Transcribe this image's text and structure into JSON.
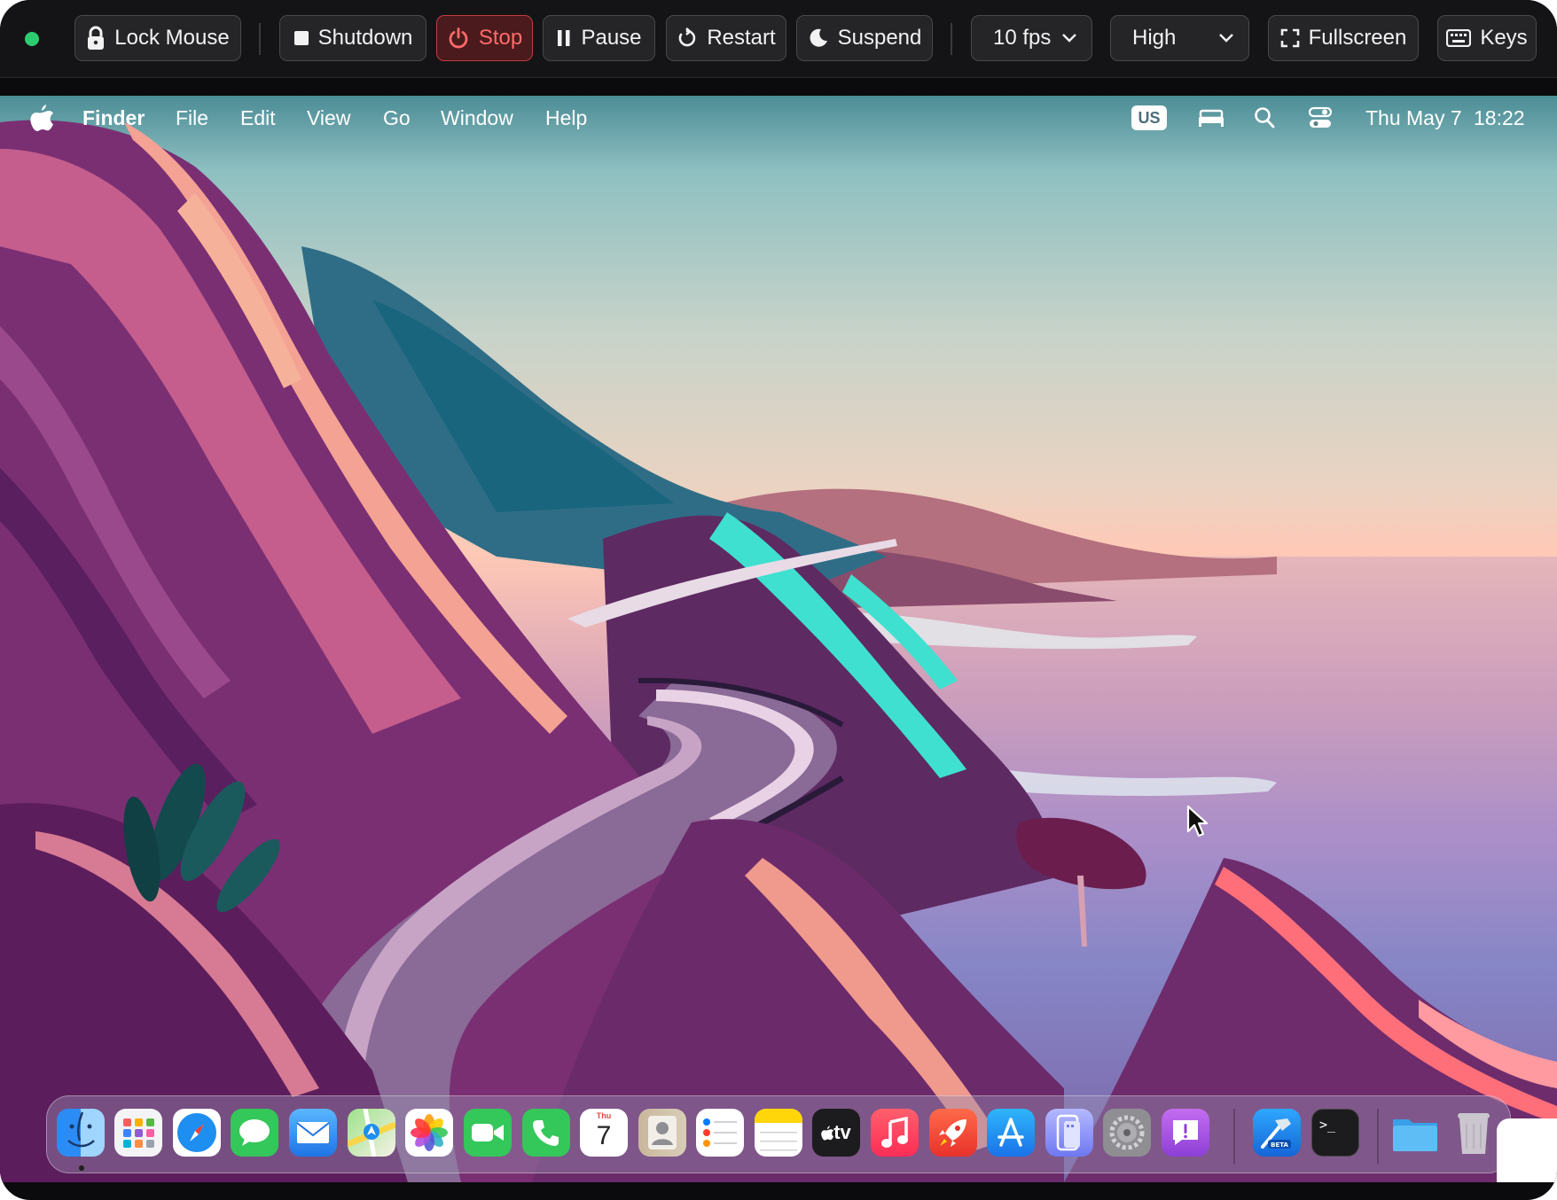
{
  "toolbar": {
    "lock_mouse": "Lock Mouse",
    "shutdown": "Shutdown",
    "stop": "Stop",
    "pause": "Pause",
    "restart": "Restart",
    "suspend": "Suspend",
    "fps_value": "10 fps",
    "quality_value": "High",
    "fullscreen": "Fullscreen",
    "keys": "Keys",
    "status_color": "#2ecc71",
    "stop_color": "#ff6b6b"
  },
  "menubar": {
    "app_name": "Finder",
    "items": [
      "File",
      "Edit",
      "View",
      "Go",
      "Window",
      "Help"
    ],
    "input_source": "US",
    "date": "Thu May 7",
    "time": "18:22"
  },
  "dock": {
    "apps": [
      "finder-icon",
      "launchpad-icon",
      "safari-icon",
      "messages-icon",
      "mail-icon",
      "maps-icon",
      "photos-icon",
      "facetime-icon",
      "phone-icon",
      "calendar-icon",
      "contacts-icon",
      "reminders-icon",
      "notes-icon",
      "apple-tv-icon",
      "music-icon",
      "rocket-icon",
      "app-store-icon",
      "iphone-mirroring-icon",
      "system-settings-icon",
      "feedback-assistant-icon",
      "xcode-beta-icon",
      "terminal-icon",
      "downloads-folder-icon",
      "trash-icon"
    ],
    "calendar_weekday": "Thu",
    "calendar_day": "7",
    "xcode_badge": "BETA",
    "terminal_prompt": ">_",
    "tv_label": "tv"
  }
}
